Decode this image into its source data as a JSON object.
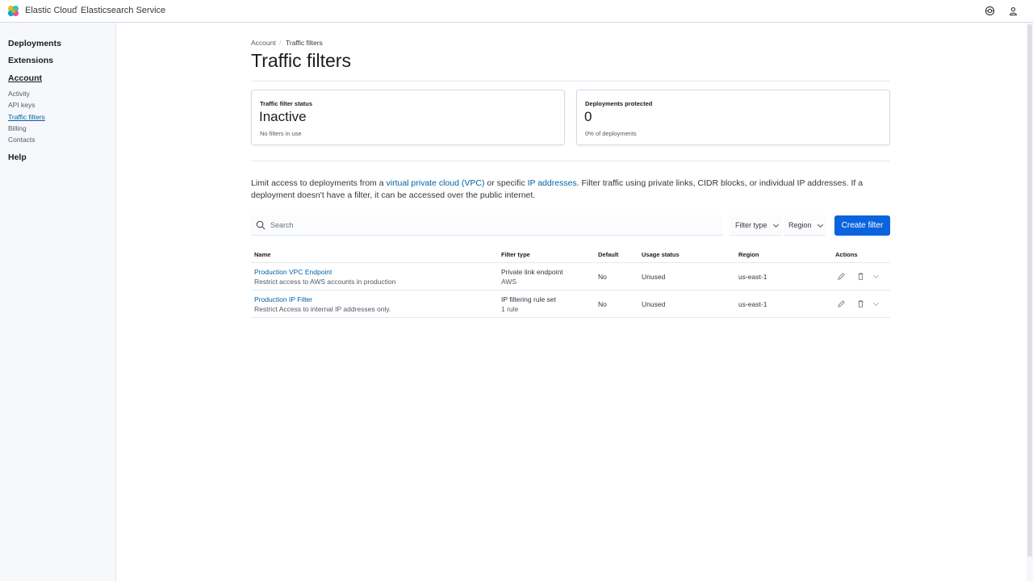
{
  "header": {
    "brand": "Elastic Cloud",
    "separator": "/",
    "service": "Elasticsearch Service",
    "icons": [
      "help-icon",
      "user-icon"
    ]
  },
  "sidebar": {
    "sections": [
      {
        "label": "Deployments"
      },
      {
        "label": "Extensions"
      },
      {
        "label": "Account"
      },
      {
        "label": "Help"
      }
    ],
    "account_items": [
      {
        "label": "Activity"
      },
      {
        "label": "API keys"
      },
      {
        "label": "Traffic filters",
        "active": true
      },
      {
        "label": "Billing"
      },
      {
        "label": "Contacts"
      }
    ]
  },
  "breadcrumb": {
    "parent": "Account",
    "current": "Traffic filters"
  },
  "page_title": "Traffic filters",
  "panels": {
    "status": {
      "label": "Traffic filter status",
      "value": "Inactive",
      "desc": "No filters in use"
    },
    "protected": {
      "label": "Deployments protected",
      "value": "0",
      "desc": "0% of deployments"
    }
  },
  "description": {
    "part1": "Limit access to deployments from a ",
    "link_vpc": "virtual private cloud (VPC)",
    "part2": " or specific ",
    "link_ip": "IP addresses",
    "part3": ". Filter traffic using private links, CIDR blocks, or individual IP addresses. If a deployment doesn't have a filter, it can be accessed over the public internet."
  },
  "toolbar": {
    "search_placeholder": "Search",
    "filter_type_label": "Filter type",
    "region_label": "Region",
    "create_label": "Create filter"
  },
  "table": {
    "columns": [
      "Name",
      "Filter type",
      "Default",
      "Usage status",
      "Region",
      "Actions"
    ],
    "rows": [
      {
        "name": "Production VPC Endpoint",
        "description": "Restrict access to AWS accounts in production",
        "filter_type": "Private link endpoint",
        "filter_sub": "AWS",
        "default": "No",
        "usage": "Unused",
        "region": "us-east-1"
      },
      {
        "name": "Production IP Filter",
        "description": "Restrict Access to internal IP addresses only.",
        "filter_type": "IP filtering rule set",
        "filter_sub": "1 rule",
        "default": "No",
        "usage": "Unused",
        "region": "us-east-1"
      }
    ]
  },
  "colors": {
    "accent": "#0b64dd",
    "link": "#0061a6",
    "border": "#d3dae6"
  }
}
